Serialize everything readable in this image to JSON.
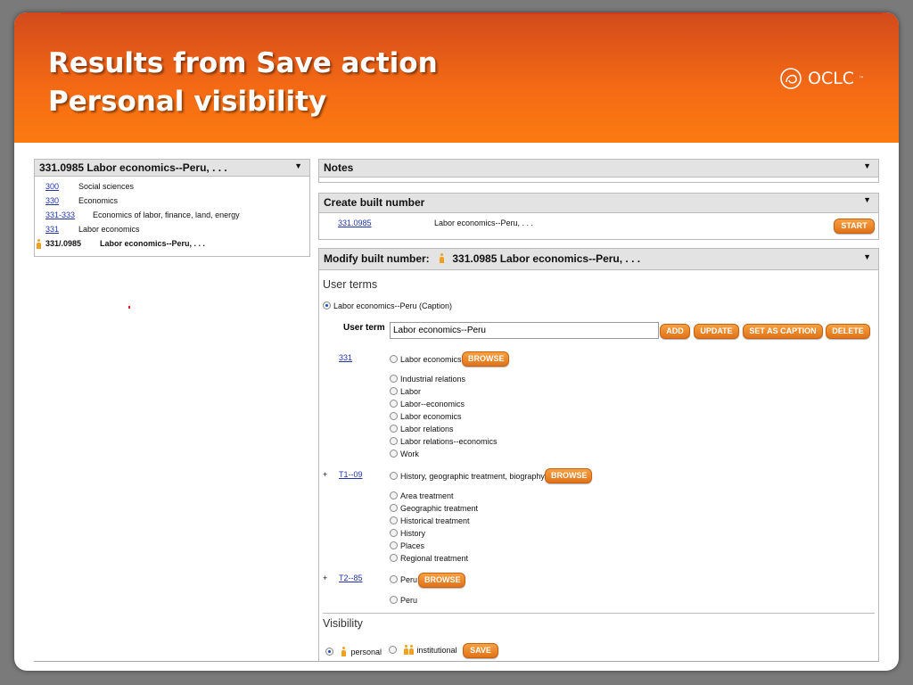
{
  "slide": {
    "title_line1": "Results from Save action",
    "title_line2": "Personal visibility",
    "logo_text": "OCLC",
    "logo_tm": "™"
  },
  "hierarchy_panel": {
    "header": "331.0985 Labor economics--Peru, . . .",
    "rows": [
      {
        "number": "300",
        "label": "Social sciences"
      },
      {
        "number": "330",
        "label": "Economics"
      },
      {
        "number": "331-333",
        "label": "Economics of labor, finance, land, energy"
      },
      {
        "number": "331",
        "label": "Labor economics"
      },
      {
        "number": "331/.0985",
        "label": "Labor economics--Peru, . . ."
      }
    ]
  },
  "notes_panel": {
    "header": "Notes"
  },
  "create_panel": {
    "header": "Create built number",
    "number": "331.0985",
    "caption": "Labor economics--Peru, . . .",
    "start_label": "START"
  },
  "modify_panel": {
    "header_prefix": "Modify built number:",
    "header_value": "331.0985 Labor economics--Peru, . . .",
    "user_terms_title": "User terms",
    "selected_term": "Labor economics--Peru  (Caption)",
    "user_term_label": "User term",
    "user_term_value": "Labor economics--Peru",
    "buttons": {
      "add": "ADD",
      "update": "UPDATE",
      "set_caption": "SET AS CAPTION",
      "delete": "DELETE",
      "browse": "BROWSE",
      "save": "SAVE"
    },
    "groups": [
      {
        "plus": "",
        "link": "331",
        "main": "Labor economics",
        "options": [
          "Industrial relations",
          "Labor",
          "Labor--economics",
          "Labor economics",
          "Labor relations",
          "Labor relations--economics",
          "Work"
        ]
      },
      {
        "plus": "+",
        "link": "T1--09",
        "main": "History, geographic treatment, biography",
        "options": [
          "Area treatment",
          "Geographic treatment",
          "Historical treatment",
          "History",
          "Places",
          "Regional treatment"
        ]
      },
      {
        "plus": "+",
        "link": "T2--85",
        "main": "Peru",
        "options": [
          "Peru"
        ]
      }
    ],
    "visibility_title": "Visibility",
    "visibility_personal": "personal",
    "visibility_institutional": "institutional"
  },
  "colors": {
    "header_orange": "#f56b14",
    "button_orange": "#e0731a",
    "link_blue": "#2233aa"
  }
}
